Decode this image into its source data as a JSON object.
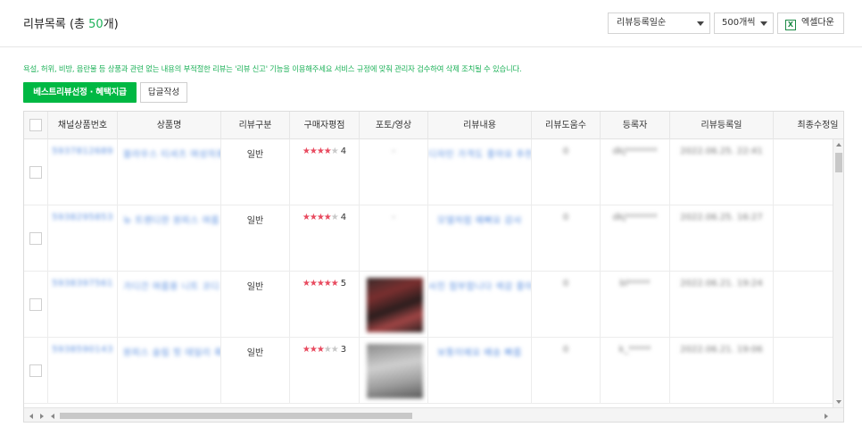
{
  "header": {
    "title_prefix": "리뷰목록 (총 ",
    "count": "50",
    "title_suffix": "개)",
    "sort_value": "리뷰등록일순",
    "per_page_value": "500개씩",
    "excel_label": "엑셀다운"
  },
  "notice": "욕설, 허위, 비방, 음란물 등 상품과 관련 없는 내용의 부적절한 리뷰는 '리뷰 신고' 기능을 이용해주세요 서비스 규정에 맞춰 관리자 검수하여 삭제 조치될 수 있습니다.",
  "actions": {
    "best_label": "베스트리뷰선정 · 혜택지급",
    "reply_label": "답글작성"
  },
  "columns": [
    "채널상품번호",
    "상품명",
    "리뷰구분",
    "구매자평점",
    "포토/영상",
    "리뷰내용",
    "리뷰도움수",
    "등록자",
    "리뷰등록일",
    "최종수정일"
  ],
  "rows": [
    {
      "product_no": "5937812689",
      "product_name": "블라우스 티셔츠 여성의류 코디",
      "type": "일반",
      "rating": 4,
      "photo": "-",
      "content": "디자인 가격도 좋아요 추천",
      "helpful": "0",
      "author": "dkj*******",
      "date": "2022.06.25. 22:41",
      "modified": "-"
    },
    {
      "product_no": "5938295853",
      "product_name": "뉴 트렌디한 원피스 여름",
      "type": "일반",
      "rating": 4,
      "photo": "-",
      "content": "모델처럼 예뻐요 감사",
      "helpful": "0",
      "author": "dkj*******",
      "date": "2022.06.25. 16:27",
      "modified": "-"
    },
    {
      "product_no": "5938397561",
      "product_name": "가디건 여름용 니트 코디 세트",
      "type": "일반",
      "rating": 5,
      "photo": "photo",
      "content": "사진 첨부합니다 색감 좋아요",
      "helpful": "0",
      "author": "bl*****",
      "date": "2022.06.21. 19:24",
      "modified": "-"
    },
    {
      "product_no": "5938590143",
      "product_name": "원피스 슬림 핏 데일리 룩",
      "type": "일반",
      "rating": 3,
      "photo": "photo",
      "content": "보통이에요 배송 빠름",
      "helpful": "0",
      "author": "k_*****",
      "date": "2022.06.21. 19:06",
      "modified": "-"
    }
  ],
  "icons": {
    "excel": "excel-icon",
    "sort_caret": "chevron-down-icon"
  },
  "colors": {
    "accent": "#00b843",
    "star": "#e84a5f",
    "link": "#5b8fe0"
  }
}
